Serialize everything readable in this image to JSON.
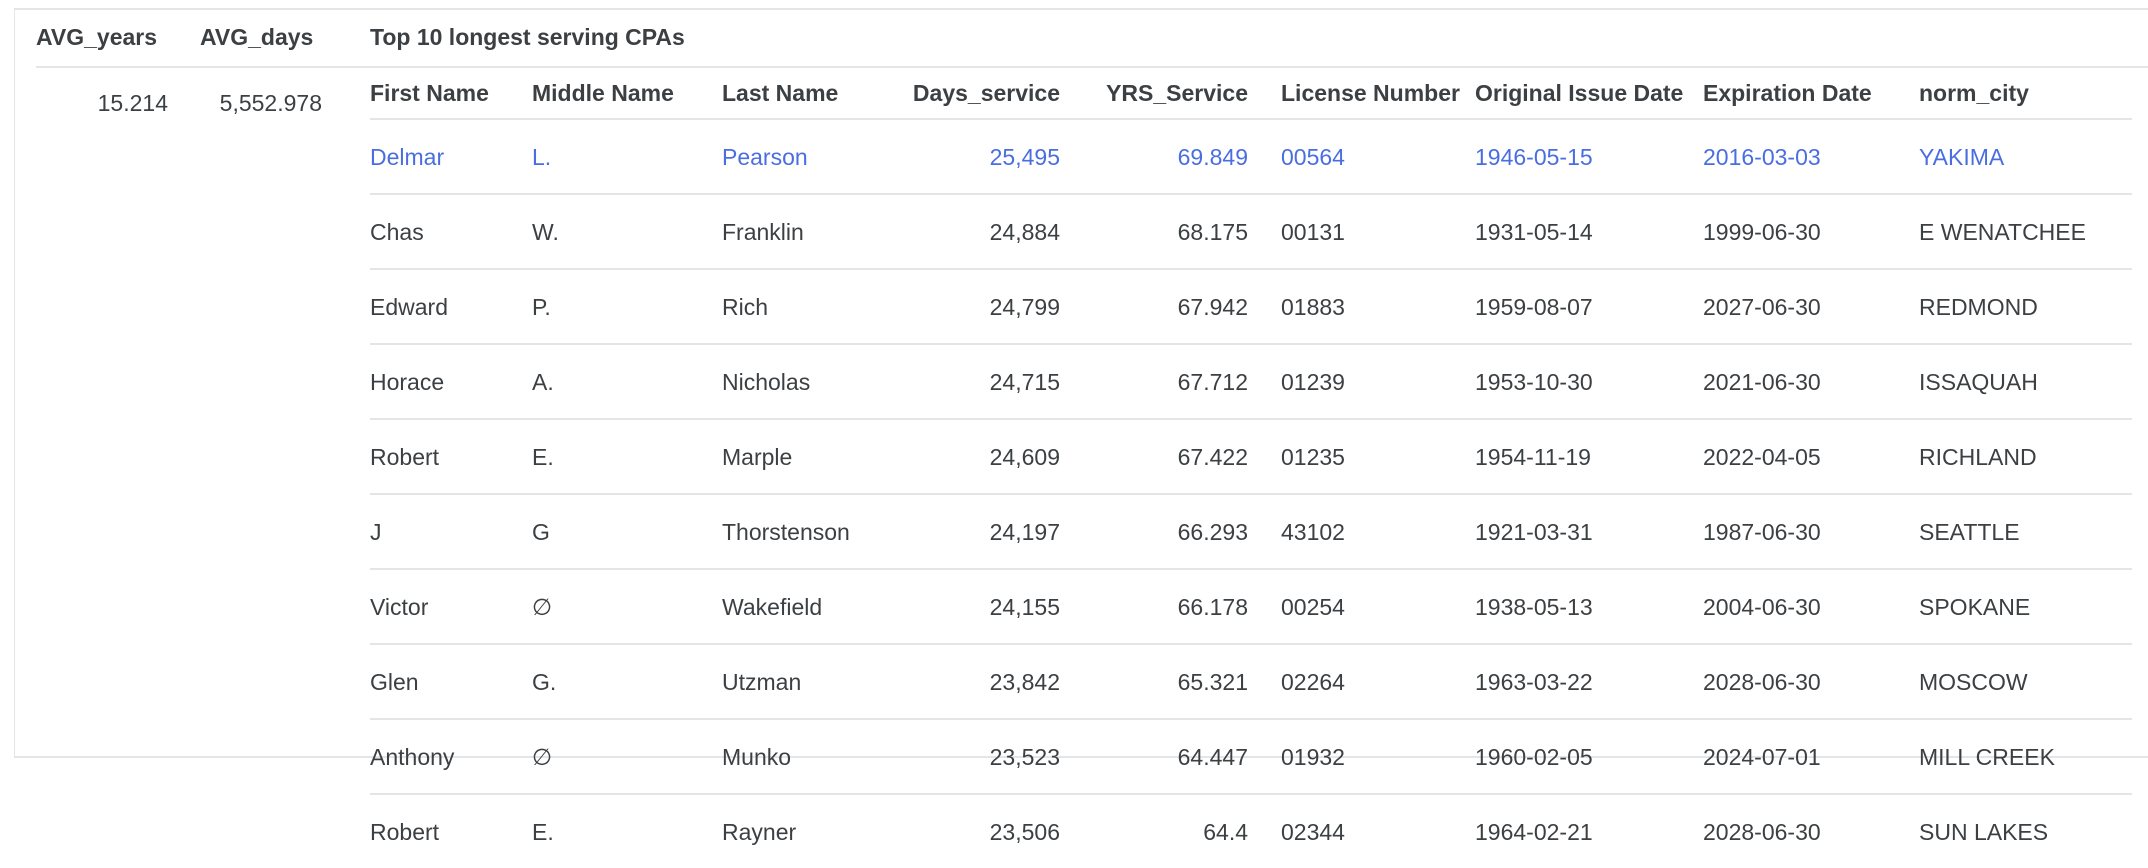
{
  "headers": {
    "avg_years": "AVG_years",
    "avg_days": "AVG_days",
    "top10": "Top 10 longest serving CPAs"
  },
  "values": {
    "avg_years": "15.214",
    "avg_days": "5,552.978"
  },
  "columns": {
    "first_name": "First Name",
    "middle_name": "Middle Name",
    "last_name": "Last Name",
    "days_service": "Days_service",
    "yrs_service": "YRS_Service",
    "license_number": "License Number",
    "original_issue_date": "Original Issue Date",
    "expiration_date": "Expiration Date",
    "norm_city": "norm_city"
  },
  "rows": [
    {
      "first": "Delmar",
      "middle": "L.",
      "last": "Pearson",
      "days": "25,495",
      "yrs": "69.849",
      "license": "00564",
      "issue": "1946-05-15",
      "expiration": "2016-03-03",
      "city": "YAKIMA"
    },
    {
      "first": "Chas",
      "middle": "W.",
      "last": "Franklin",
      "days": "24,884",
      "yrs": "68.175",
      "license": "00131",
      "issue": "1931-05-14",
      "expiration": "1999-06-30",
      "city": "E WENATCHEE"
    },
    {
      "first": "Edward",
      "middle": "P.",
      "last": "Rich",
      "days": "24,799",
      "yrs": "67.942",
      "license": "01883",
      "issue": "1959-08-07",
      "expiration": "2027-06-30",
      "city": "REDMOND"
    },
    {
      "first": "Horace",
      "middle": "A.",
      "last": "Nicholas",
      "days": "24,715",
      "yrs": "67.712",
      "license": "01239",
      "issue": "1953-10-30",
      "expiration": "2021-06-30",
      "city": "ISSAQUAH"
    },
    {
      "first": "Robert",
      "middle": "E.",
      "last": "Marple",
      "days": "24,609",
      "yrs": "67.422",
      "license": "01235",
      "issue": "1954-11-19",
      "expiration": "2022-04-05",
      "city": "RICHLAND"
    },
    {
      "first": "J",
      "middle": "G",
      "last": "Thorstenson",
      "days": "24,197",
      "yrs": "66.293",
      "license": "43102",
      "issue": "1921-03-31",
      "expiration": "1987-06-30",
      "city": "SEATTLE"
    },
    {
      "first": "Victor",
      "middle": "∅",
      "last": "Wakefield",
      "days": "24,155",
      "yrs": "66.178",
      "license": "00254",
      "issue": "1938-05-13",
      "expiration": "2004-06-30",
      "city": "SPOKANE"
    },
    {
      "first": "Glen",
      "middle": "G.",
      "last": "Utzman",
      "days": "23,842",
      "yrs": "65.321",
      "license": "02264",
      "issue": "1963-03-22",
      "expiration": "2028-06-30",
      "city": "MOSCOW"
    },
    {
      "first": "Anthony",
      "middle": "∅",
      "last": "Munko",
      "days": "23,523",
      "yrs": "64.447",
      "license": "01932",
      "issue": "1960-02-05",
      "expiration": "2024-07-01",
      "city": "MILL CREEK"
    },
    {
      "first": "Robert",
      "middle": "E.",
      "last": "Rayner",
      "days": "23,506",
      "yrs": "64.4",
      "license": "02344",
      "issue": "1964-02-21",
      "expiration": "2028-06-30",
      "city": "SUN LAKES"
    }
  ],
  "highlight_color": "#4a6ee0"
}
